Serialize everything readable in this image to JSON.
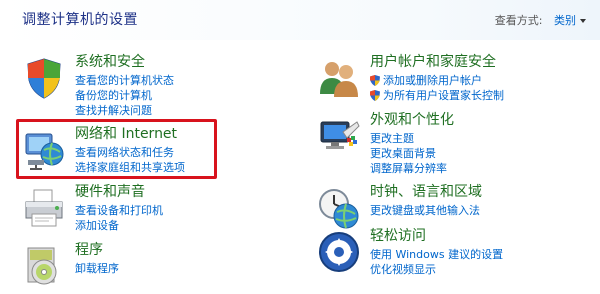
{
  "header": {
    "title": "调整计算机的设置",
    "view_by_label": "查看方式:",
    "view_by_value": "类别"
  },
  "categories": {
    "system_security": {
      "title": "系统和安全",
      "links": [
        "查看您的计算机状态",
        "备份您的计算机",
        "查找并解决问题"
      ]
    },
    "network": {
      "title": "网络和 Internet",
      "links": [
        "查看网络状态和任务",
        "选择家庭组和共享选项"
      ]
    },
    "hardware": {
      "title": "硬件和声音",
      "links": [
        "查看设备和打印机",
        "添加设备"
      ]
    },
    "programs": {
      "title": "程序",
      "links": [
        "卸载程序"
      ]
    },
    "user_accounts": {
      "title": "用户帐户和家庭安全",
      "links": [
        "添加或删除用户帐户",
        "为所有用户设置家长控制"
      ]
    },
    "appearance": {
      "title": "外观和个性化",
      "links": [
        "更改主题",
        "更改桌面背景",
        "调整屏幕分辨率"
      ]
    },
    "clock": {
      "title": "时钟、语言和区域",
      "links": [
        "更改键盘或其他输入法"
      ]
    },
    "ease_access": {
      "title": "轻松访问",
      "links": [
        "使用 Windows 建议的设置",
        "优化视频显示"
      ]
    }
  },
  "colors": {
    "category_title": "#1f6f22",
    "link": "#0066cc",
    "page_title": "#1e3287",
    "highlight_border": "#d8131d"
  },
  "icons": {
    "system_security": "flag-shield-icon",
    "network": "network-globe-icon",
    "hardware": "printer-icon",
    "programs": "program-disc-icon",
    "user_accounts": "users-icon",
    "appearance": "monitor-palette-icon",
    "clock": "clock-globe-icon",
    "ease_access": "ease-of-access-icon"
  }
}
